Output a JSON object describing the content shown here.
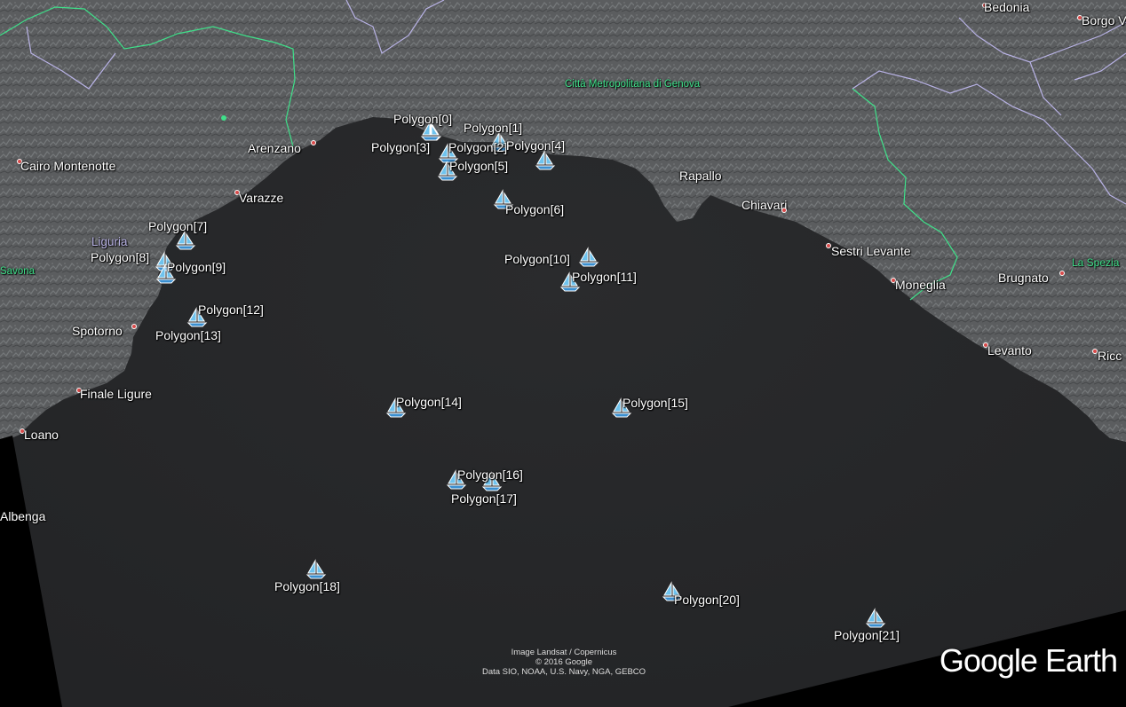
{
  "colors": {
    "sea": "#27282a",
    "land": "#5d5f61",
    "boundary_green": "#3fe08a",
    "boundary_violet": "#b9b3e6",
    "place_dot": "#d84a4a",
    "marker_blue": "#6fc3ee"
  },
  "places": [
    {
      "name": "Bedonia"
    },
    {
      "name": "Borgo V"
    },
    {
      "name": "Città Metropolitana di Genova"
    },
    {
      "name": "Arenzano"
    },
    {
      "name": "Cairo Montenotte"
    },
    {
      "name": "Varazze"
    },
    {
      "name": "Rapallo"
    },
    {
      "name": "Chiavari"
    },
    {
      "name": "Sestri Levante"
    },
    {
      "name": "Moneglia"
    },
    {
      "name": "Brugnato"
    },
    {
      "name": "La Spezia"
    },
    {
      "name": "Liguria"
    },
    {
      "name": "Savona"
    },
    {
      "name": "Spotorno"
    },
    {
      "name": "Finale Ligure"
    },
    {
      "name": "Loano"
    },
    {
      "name": "Albenga"
    },
    {
      "name": "Levanto"
    },
    {
      "name": "Ricc"
    }
  ],
  "markers": [
    {
      "label": "Polygon[0]",
      "icon": "sailboat-icon"
    },
    {
      "label": "Polygon[1]",
      "icon": "sailboat-icon"
    },
    {
      "label": "Polygon[2]",
      "icon": "sailboat-icon"
    },
    {
      "label": "Polygon[3]",
      "icon": "sailboat-icon"
    },
    {
      "label": "Polygon[4]",
      "icon": "sailboat-icon"
    },
    {
      "label": "Polygon[5]",
      "icon": "sailboat-icon"
    },
    {
      "label": "Polygon[6]",
      "icon": "sailboat-icon"
    },
    {
      "label": "Polygon[7]",
      "icon": "sailboat-icon"
    },
    {
      "label": "Polygon[8]",
      "icon": "sailboat-icon"
    },
    {
      "label": "Polygon[9]",
      "icon": "sailboat-icon"
    },
    {
      "label": "Polygon[10]",
      "icon": "sailboat-icon"
    },
    {
      "label": "Polygon[11]",
      "icon": "sailboat-icon"
    },
    {
      "label": "Polygon[12]",
      "icon": "sailboat-icon"
    },
    {
      "label": "Polygon[13]",
      "icon": "sailboat-icon"
    },
    {
      "label": "Polygon[14]",
      "icon": "sailboat-icon"
    },
    {
      "label": "Polygon[15]",
      "icon": "sailboat-icon"
    },
    {
      "label": "Polygon[16]",
      "icon": "sailboat-icon"
    },
    {
      "label": "Polygon[17]",
      "icon": "sailboat-icon"
    },
    {
      "label": "Polygon[18]",
      "icon": "sailboat-icon"
    },
    {
      "label": "Polygon[20]",
      "icon": "sailboat-icon"
    },
    {
      "label": "Polygon[21]",
      "icon": "sailboat-icon"
    }
  ],
  "attribution": {
    "line1": "Image Landsat / Copernicus",
    "line2": "© 2016 Google",
    "line3": "Data SIO, NOAA, U.S. Navy, NGA, GEBCO"
  },
  "logo": {
    "word1": "Google",
    "word2": "Earth"
  }
}
